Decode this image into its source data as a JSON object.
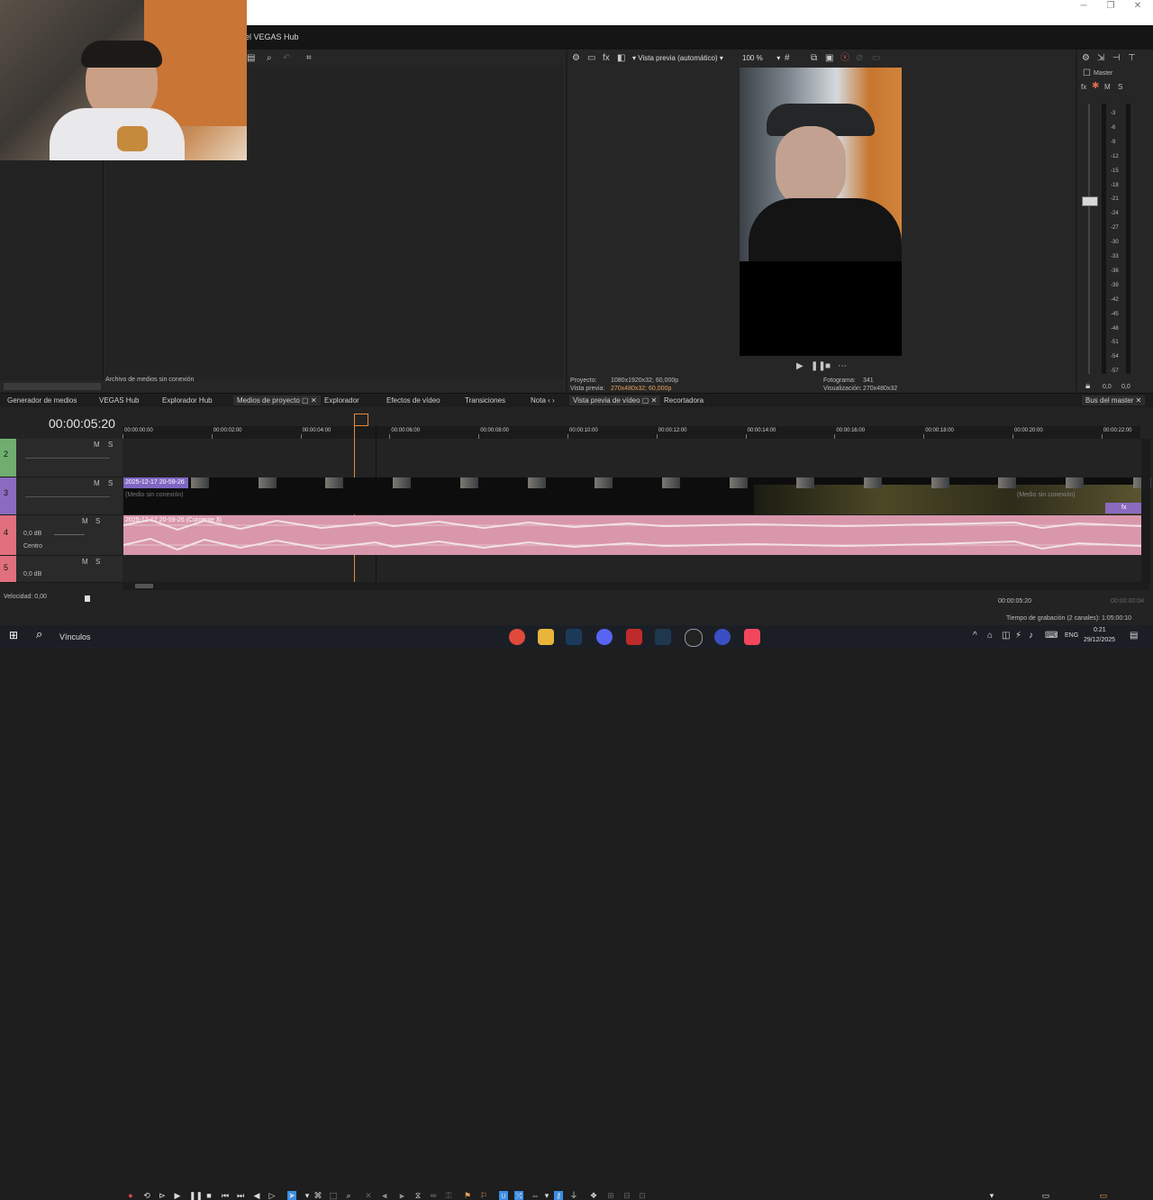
{
  "window": {
    "hub_title": "el VEGAS Hub",
    "minimize": "─",
    "maximize": "❐",
    "close": "✕"
  },
  "preview": {
    "mode": "Vista previa (automático)",
    "zoom": "100 %",
    "proyecto_label": "Proyecto:",
    "proyecto_value": "1080x1920x32; 60,000p",
    "vista_label": "Vista previa:",
    "vista_value": "270x480x32; 60,000p",
    "fotograma_label": "Fotograma:",
    "fotograma_value": "341",
    "visualizacion_label": "Visualización:",
    "visualizacion_value": "270x480x32"
  },
  "media": {
    "offline_text": "Archivo de medios sin conexión"
  },
  "bottom_tabs": [
    "Generador de medios",
    "VEGAS Hub",
    "Explorador Hub",
    "Medios de proyecto",
    "Explorador",
    "Efectos de vídeo",
    "Transiciones",
    "Nota"
  ],
  "preview_tabs": [
    "Vista previa de vídeo",
    "Recortadora"
  ],
  "bus_tab": "Bus del master",
  "master": {
    "label": "Master",
    "fx": "fx",
    "m": "M",
    "s": "S",
    "ticks": [
      "3",
      "6",
      "9",
      "12",
      "15",
      "18",
      "21",
      "24",
      "27",
      "30",
      "33",
      "36",
      "39",
      "42",
      "45",
      "48",
      "51",
      "54",
      "57"
    ],
    "left_value": "0,0",
    "right_value": "0,0"
  },
  "timeline": {
    "timecode": "00:00:05:20",
    "ruler": [
      "00:00:00:00",
      "00:00:02:00",
      "00:00:04:00",
      "00:00:06:00",
      "00:00:08:00",
      "00:00:10:00",
      "00:00:12:00",
      "00:00:14:00",
      "00:00:16:00",
      "00:00:18:00",
      "00:00:20:00",
      "00:00:22:00"
    ],
    "tracks": [
      {
        "num": "2",
        "m": "M",
        "s": "S"
      },
      {
        "num": "3",
        "m": "M",
        "s": "S"
      },
      {
        "num": "4",
        "m": "M",
        "s": "S",
        "db": "0,0 dB",
        "pan": "Centro"
      },
      {
        "num": "5",
        "m": "M",
        "s": "S",
        "db": "0,0 dB"
      }
    ],
    "video_clip_label": "2025-12-17 20-59-26",
    "video_offline": "(Medio sin conexión)",
    "video_offline_end": "(Medio sin conexión)",
    "audio_clip_label": "2025-12-17 20-59-26 (Corriente 3)",
    "velocidad": "Velocidad: 0,00",
    "cursor_time": "00:00:05:20",
    "end_time": "00:00:00:04",
    "fx": "fx"
  },
  "status": {
    "recording_time": "Tiempo de grabación (2 canales): 1:05:00:10"
  },
  "taskbar": {
    "search_label": "Vínculos",
    "lang": "ENG",
    "time": "0:21",
    "date": "29/12/2025"
  },
  "colors": {
    "accent": "#3a8ee6",
    "audio_clip": "#d997ab",
    "track_green": "#6fae6f",
    "track_purple": "#8a6bbf",
    "track_red": "#e0707d"
  }
}
